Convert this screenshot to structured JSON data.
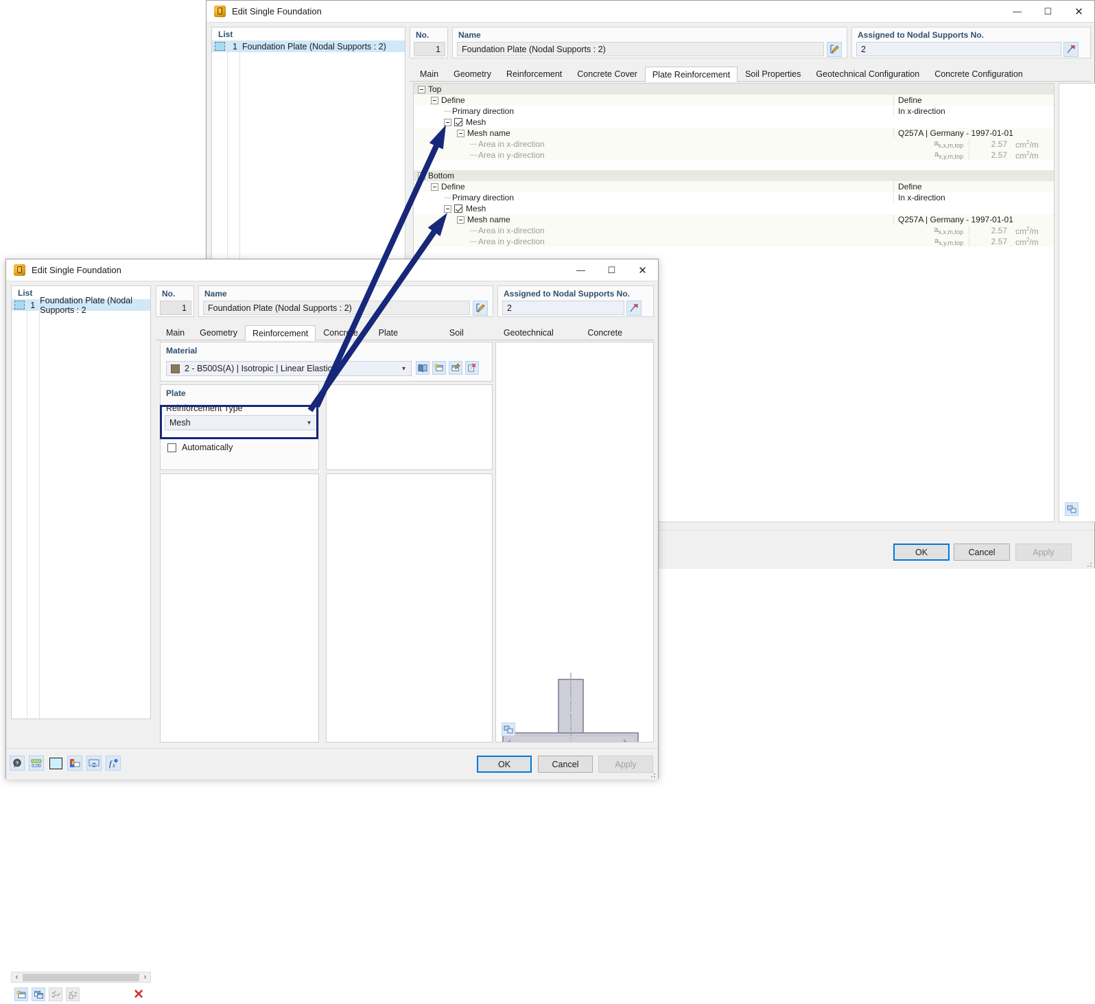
{
  "back_window": {
    "title": "Edit Single Foundation",
    "icon": "app-icon",
    "window_buttons": {
      "minimize": "—",
      "maximize": "☐",
      "close": "✕"
    },
    "list": {
      "header": "List",
      "items": [
        {
          "num": "1",
          "label": "Foundation Plate (Nodal Supports : 2)"
        }
      ]
    },
    "no": {
      "label": "No.",
      "value": "1"
    },
    "name": {
      "label": "Name",
      "value": "Foundation Plate (Nodal Supports : 2)",
      "edit_icon": "edit-pencil-icon"
    },
    "assigned": {
      "label": "Assigned to Nodal Supports No.",
      "value": "2",
      "pick_icon": "select-objects-icon"
    },
    "tabs": [
      {
        "label": "Main",
        "active": false
      },
      {
        "label": "Geometry",
        "active": false
      },
      {
        "label": "Reinforcement",
        "active": false
      },
      {
        "label": "Concrete Cover",
        "active": false
      },
      {
        "label": "Plate Reinforcement",
        "active": true
      },
      {
        "label": "Soil Properties",
        "active": false
      },
      {
        "label": "Geotechnical Configuration",
        "active": false
      },
      {
        "label": "Concrete Configuration",
        "active": false
      }
    ],
    "tree": [
      {
        "indent": 0,
        "kind": "group",
        "expander": true,
        "label": "Top",
        "symbol": "",
        "value": "",
        "unit": ""
      },
      {
        "indent": 1,
        "kind": "node",
        "expander": true,
        "label": "Define",
        "symbol": "",
        "value": "Define",
        "unit": ""
      },
      {
        "indent": 2,
        "kind": "leaf",
        "expander": false,
        "label": "Primary direction",
        "symbol": "",
        "value": "In x-direction",
        "unit": ""
      },
      {
        "indent": 2,
        "kind": "checkbox",
        "expander": true,
        "label": "Mesh",
        "symbol": "",
        "value": "",
        "unit": "",
        "checked": true
      },
      {
        "indent": 3,
        "kind": "node",
        "expander": true,
        "label": "Mesh name",
        "symbol": "",
        "value": "Q257A | Germany - 1997-01-01",
        "unit": ""
      },
      {
        "indent": 4,
        "kind": "dim",
        "expander": false,
        "label": "Area in x-direction",
        "symbol": "as,x,m,top",
        "value": "2.57",
        "unit": "cm2/m"
      },
      {
        "indent": 4,
        "kind": "dim",
        "expander": false,
        "label": "Area in y-direction",
        "symbol": "as,y,m,top",
        "value": "2.57",
        "unit": "cm2/m"
      },
      {
        "indent": 0,
        "kind": "spacer",
        "expander": false,
        "label": "",
        "symbol": "",
        "value": "",
        "unit": ""
      },
      {
        "indent": 0,
        "kind": "group",
        "expander": true,
        "label": "Bottom",
        "symbol": "",
        "value": "",
        "unit": ""
      },
      {
        "indent": 1,
        "kind": "node",
        "expander": true,
        "label": "Define",
        "symbol": "",
        "value": "Define",
        "unit": ""
      },
      {
        "indent": 2,
        "kind": "leaf",
        "expander": false,
        "label": "Primary direction",
        "symbol": "",
        "value": "In x-direction",
        "unit": ""
      },
      {
        "indent": 2,
        "kind": "checkbox",
        "expander": true,
        "label": "Mesh",
        "symbol": "",
        "value": "",
        "unit": "",
        "checked": true
      },
      {
        "indent": 3,
        "kind": "node",
        "expander": true,
        "label": "Mesh name",
        "symbol": "",
        "value": "Q257A | Germany - 1997-01-01",
        "unit": ""
      },
      {
        "indent": 4,
        "kind": "dim",
        "expander": false,
        "label": "Area in x-direction",
        "symbol": "as,x,m,top",
        "value": "2.57",
        "unit": "cm2/m"
      },
      {
        "indent": 4,
        "kind": "dim",
        "expander": false,
        "label": "Area in y-direction",
        "symbol": "as,y,m,top",
        "value": "2.57",
        "unit": "cm2/m"
      }
    ],
    "preview_icon": "render-settings-icon",
    "footer": {
      "ok": "OK",
      "cancel": "Cancel",
      "apply": "Apply"
    }
  },
  "front_window": {
    "title": "Edit Single Foundation",
    "icon": "app-icon",
    "window_buttons": {
      "minimize": "—",
      "maximize": "☐",
      "close": "✕"
    },
    "list": {
      "header": "List",
      "items": [
        {
          "num": "1",
          "label": "Foundation Plate (Nodal Supports : 2"
        }
      ],
      "toolbar": [
        {
          "name": "new-item-icon",
          "enabled": true
        },
        {
          "name": "copy-item-icon",
          "enabled": true
        },
        {
          "name": "select-all-icon",
          "enabled": false
        },
        {
          "name": "invert-selection-icon",
          "enabled": false
        },
        {
          "name": "delete-item-icon",
          "enabled": true
        }
      ],
      "scroll": {
        "left": "‹",
        "right": "›"
      }
    },
    "no": {
      "label": "No.",
      "value": "1"
    },
    "name": {
      "label": "Name",
      "value": "Foundation Plate (Nodal Supports : 2)",
      "edit_icon": "edit-pencil-icon"
    },
    "assigned": {
      "label": "Assigned to Nodal Supports No.",
      "value": "2",
      "pick_icon": "select-objects-icon"
    },
    "tabs": [
      {
        "label": "Main",
        "active": false
      },
      {
        "label": "Geometry",
        "active": false
      },
      {
        "label": "Reinforcement",
        "active": true
      },
      {
        "label": "Concrete Cover",
        "active": false
      },
      {
        "label": "Plate Reinforcement",
        "active": false
      },
      {
        "label": "Soil Properties",
        "active": false
      },
      {
        "label": "Geotechnical Configuration",
        "active": false
      },
      {
        "label": "Concrete Configuration",
        "active": false
      }
    ],
    "material": {
      "section_label": "Material",
      "value": "2 - B500S(A) | Isotropic | Linear Elastic",
      "swatch_color": "#8a7a5c",
      "buttons": [
        {
          "name": "material-library-icon"
        },
        {
          "name": "new-material-icon"
        },
        {
          "name": "edit-material-icon"
        },
        {
          "name": "delete-material-icon"
        }
      ]
    },
    "plate": {
      "section_label": "Plate",
      "reinforcement_type": {
        "label": "Reinforcement Type",
        "value": "Mesh"
      },
      "automatically": {
        "label": "Automatically",
        "checked": false
      }
    },
    "preview_icon": "render-settings-icon",
    "footer": {
      "ok": "OK",
      "cancel": "Cancel",
      "apply": "Apply"
    }
  },
  "annotations": {
    "arrow_color": "#17277a",
    "highlight_color": "#17277a",
    "arrows": [
      {
        "name": "arrow-to-top-mesh",
        "from": [
          462,
          592
        ],
        "to": [
          650,
          182
        ]
      },
      {
        "name": "arrow-to-bottom-mesh",
        "from": [
          452,
          598
        ],
        "to": [
          652,
          310
        ]
      }
    ]
  }
}
